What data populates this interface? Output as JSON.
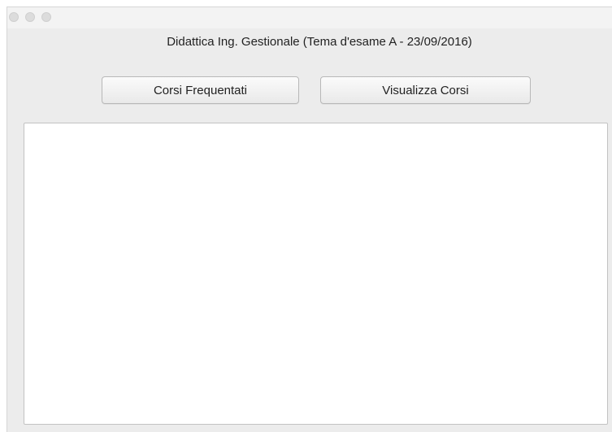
{
  "window": {
    "title_text": "Didattica Ing. Gestionale (Tema d'esame A -  23/09/2016)"
  },
  "toolbar": {
    "corsi_frequentati_label": "Corsi Frequentati",
    "visualizza_corsi_label": "Visualizza Corsi"
  },
  "output": {
    "value": ""
  },
  "colors": {
    "window_background": "#ececec",
    "titlebar_background": "#f3f3f3",
    "text_area_background": "#ffffff"
  }
}
